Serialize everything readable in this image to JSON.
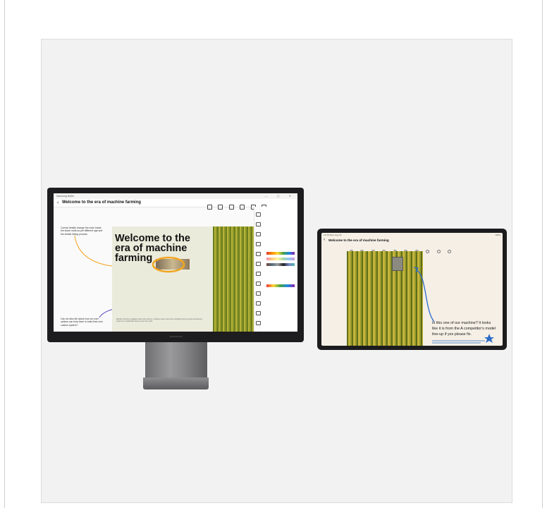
{
  "monitor": {
    "app_name": "Samsung Notes",
    "window_controls": "— ▢ ✕",
    "note_title": "Welcome to the era of machine farming",
    "back_icon": "chevron-left-icon",
    "side_note_1": "Correct details change the main inside the share mark as per different age and the similar listing process",
    "side_note_2": "Can we also tell about how our user options can help them to build their own custom system?",
    "slide_title": "Welcome to the era of machine farming",
    "slide_body": "Machine farming: intelligent tools with sensors, machine vision and AI are reshaping how we grow and harvest crops for a sustainable future across the world.",
    "brand": "SAMSUNG"
  },
  "tablet": {
    "status_time": "12:45 Wed, Aug 23",
    "status_right": "100%",
    "note_title": "Welcome to the era of machine farming",
    "handwritten_note": "Is this one of our machine? It looks like it is from the A competitor's model line-up if yes please fix."
  },
  "colors": {
    "highlight_orange": "#f2a521",
    "pen_blue": "#2d6cc7",
    "pen_purple": "#5a3fc0"
  }
}
